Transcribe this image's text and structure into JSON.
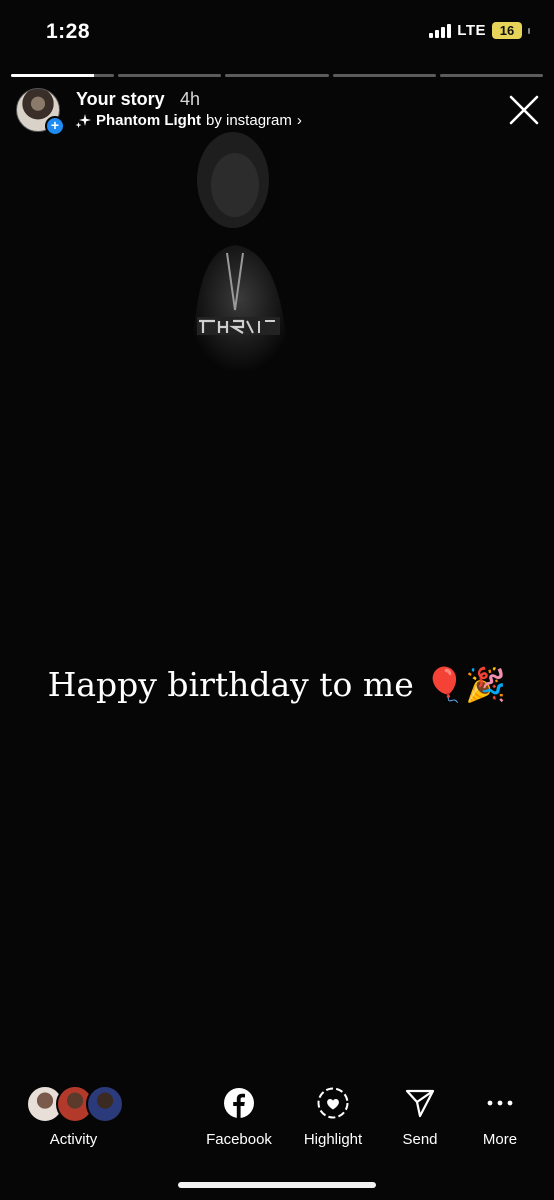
{
  "status_bar": {
    "time": "1:28",
    "network": "LTE",
    "battery": "16"
  },
  "story": {
    "segments_total": 5,
    "current_segment_progress": 0.8,
    "title": "Your story",
    "age": "4h",
    "music_track": "Phantom Light",
    "music_by": "by instagram",
    "music_chevron": "›",
    "avatar_plus": "+",
    "caption_text": "Happy birthday to me",
    "caption_emoji": "🎈🎉"
  },
  "bottom_bar": {
    "activity_label": "Activity",
    "facebook_label": "Facebook",
    "highlight_label": "Highlight",
    "send_label": "Send",
    "more_label": "More"
  },
  "colors": {
    "background": "#060606",
    "accent_blue": "#1f8bf5",
    "battery_yellow": "#e7d458"
  },
  "icons": [
    "signal-icon",
    "battery-icon",
    "sparkles-icon",
    "close-icon",
    "facebook-icon",
    "highlight-icon",
    "send-icon",
    "more-icon"
  ]
}
